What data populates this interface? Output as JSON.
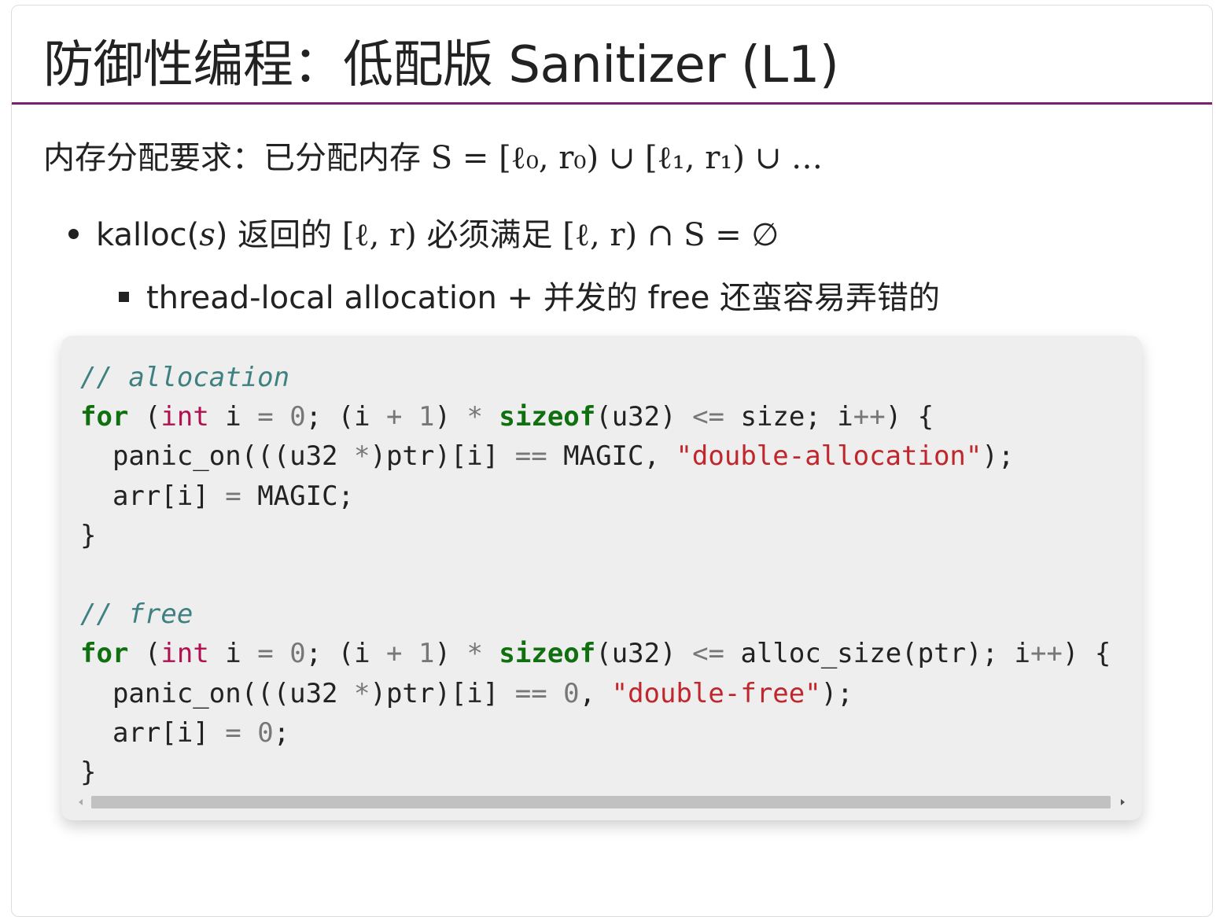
{
  "slide": {
    "title": "防御性编程：低配版 Sanitizer (L1)",
    "intro_text": "内存分配要求：已分配内存 ",
    "intro_math": "S = [ℓ₀, r₀) ∪ [ℓ₁, r₁) ∪ …",
    "bullet1": {
      "pre": "kalloc(",
      "arg": "s",
      "mid1": ") 返回的 ",
      "math1": "[ℓ, r)",
      "mid2": " 必须满足 ",
      "math2": "[ℓ, r) ∩ S = ∅"
    },
    "bullet2": "thread-local allocation + 并发的 free 还蛮容易弄错的"
  },
  "code": {
    "lines": [
      [
        {
          "t": "// allocation",
          "c": "comment"
        }
      ],
      [
        {
          "t": "for",
          "c": "kw"
        },
        {
          "t": " (",
          "c": ""
        },
        {
          "t": "int",
          "c": "type"
        },
        {
          "t": " i ",
          "c": ""
        },
        {
          "t": "=",
          "c": "op"
        },
        {
          "t": " ",
          "c": ""
        },
        {
          "t": "0",
          "c": "num"
        },
        {
          "t": "; (i ",
          "c": ""
        },
        {
          "t": "+",
          "c": "op"
        },
        {
          "t": " ",
          "c": ""
        },
        {
          "t": "1",
          "c": "num"
        },
        {
          "t": ") ",
          "c": ""
        },
        {
          "t": "*",
          "c": "op"
        },
        {
          "t": " ",
          "c": ""
        },
        {
          "t": "sizeof",
          "c": "kw"
        },
        {
          "t": "(u32) ",
          "c": ""
        },
        {
          "t": "<=",
          "c": "op"
        },
        {
          "t": " size; i",
          "c": ""
        },
        {
          "t": "++",
          "c": "op"
        },
        {
          "t": ") {",
          "c": ""
        }
      ],
      [
        {
          "t": "  panic_on(((u32 ",
          "c": ""
        },
        {
          "t": "*",
          "c": "op"
        },
        {
          "t": ")ptr)[i] ",
          "c": ""
        },
        {
          "t": "==",
          "c": "op"
        },
        {
          "t": " MAGIC, ",
          "c": ""
        },
        {
          "t": "\"double-allocation\"",
          "c": "str"
        },
        {
          "t": ");",
          "c": ""
        }
      ],
      [
        {
          "t": "  arr[i] ",
          "c": ""
        },
        {
          "t": "=",
          "c": "op"
        },
        {
          "t": " MAGIC;",
          "c": ""
        }
      ],
      [
        {
          "t": "}",
          "c": ""
        }
      ],
      [
        {
          "t": "",
          "c": ""
        }
      ],
      [
        {
          "t": "// free",
          "c": "comment"
        }
      ],
      [
        {
          "t": "for",
          "c": "kw"
        },
        {
          "t": " (",
          "c": ""
        },
        {
          "t": "int",
          "c": "type"
        },
        {
          "t": " i ",
          "c": ""
        },
        {
          "t": "=",
          "c": "op"
        },
        {
          "t": " ",
          "c": ""
        },
        {
          "t": "0",
          "c": "num"
        },
        {
          "t": "; (i ",
          "c": ""
        },
        {
          "t": "+",
          "c": "op"
        },
        {
          "t": " ",
          "c": ""
        },
        {
          "t": "1",
          "c": "num"
        },
        {
          "t": ") ",
          "c": ""
        },
        {
          "t": "*",
          "c": "op"
        },
        {
          "t": " ",
          "c": ""
        },
        {
          "t": "sizeof",
          "c": "kw"
        },
        {
          "t": "(u32) ",
          "c": ""
        },
        {
          "t": "<=",
          "c": "op"
        },
        {
          "t": " alloc_size(ptr); i",
          "c": ""
        },
        {
          "t": "++",
          "c": "op"
        },
        {
          "t": ") {",
          "c": ""
        }
      ],
      [
        {
          "t": "  panic_on(((u32 ",
          "c": ""
        },
        {
          "t": "*",
          "c": "op"
        },
        {
          "t": ")ptr)[i] ",
          "c": ""
        },
        {
          "t": "==",
          "c": "op"
        },
        {
          "t": " ",
          "c": ""
        },
        {
          "t": "0",
          "c": "num"
        },
        {
          "t": ", ",
          "c": ""
        },
        {
          "t": "\"double-free\"",
          "c": "str"
        },
        {
          "t": ");",
          "c": ""
        }
      ],
      [
        {
          "t": "  arr[i] ",
          "c": ""
        },
        {
          "t": "=",
          "c": "op"
        },
        {
          "t": " ",
          "c": ""
        },
        {
          "t": "0",
          "c": "num"
        },
        {
          "t": ";",
          "c": ""
        }
      ],
      [
        {
          "t": "}",
          "c": ""
        }
      ]
    ]
  },
  "colors": {
    "title_rule": "#7b1f6f",
    "comment": "#3f8080",
    "keyword": "#107010",
    "type": "#b01050",
    "string": "#c0272d",
    "code_bg": "#eeeeee"
  },
  "icons": {
    "scroll_left": "triangle-left-icon",
    "scroll_right": "triangle-right-icon"
  }
}
